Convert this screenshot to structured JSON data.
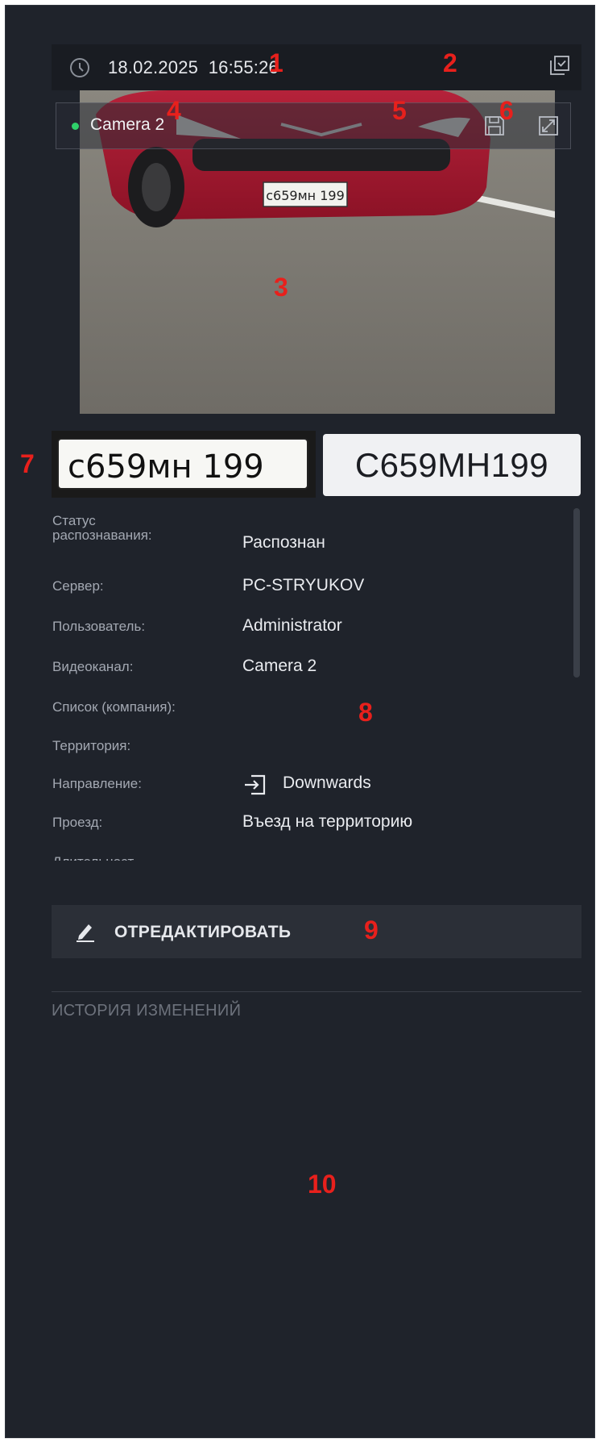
{
  "header": {
    "date": "18.02.2025",
    "time": "16:55:26"
  },
  "camera": {
    "name": "Camera 2"
  },
  "plate": {
    "photo_text": "c659мн 199",
    "recognized": "C659MH199",
    "car_plate_text": "c659мн 199"
  },
  "details": [
    {
      "label": "Статус\nраспознавания:",
      "value": "Распознан"
    },
    {
      "label": "Сервер:",
      "value": "PC-STRYUKOV"
    },
    {
      "label": "Пользователь:",
      "value": "Administrator"
    },
    {
      "label": "Видеоканал:",
      "value": "Camera 2"
    },
    {
      "label": "Список (компания):",
      "value": ""
    },
    {
      "label": "Территория:",
      "value": ""
    },
    {
      "label": "Направление:",
      "value": "Downwards"
    },
    {
      "label": "Проезд:",
      "value": "Въезд на территорию"
    },
    {
      "label": "Длительност",
      "value": ""
    }
  ],
  "actions": {
    "edit_label": "ОТРЕДАКТИРОВАТЬ"
  },
  "history": {
    "title": "ИСТОРИЯ ИЗМЕНЕНИЙ"
  },
  "annotations": [
    "1",
    "2",
    "3",
    "4",
    "5",
    "6",
    "7",
    "8",
    "9",
    "10"
  ],
  "colors": {
    "panel": "#1f232b",
    "accent_dot": "#2fd06a",
    "annotation": "#e8201c",
    "car": "#a3142a"
  }
}
